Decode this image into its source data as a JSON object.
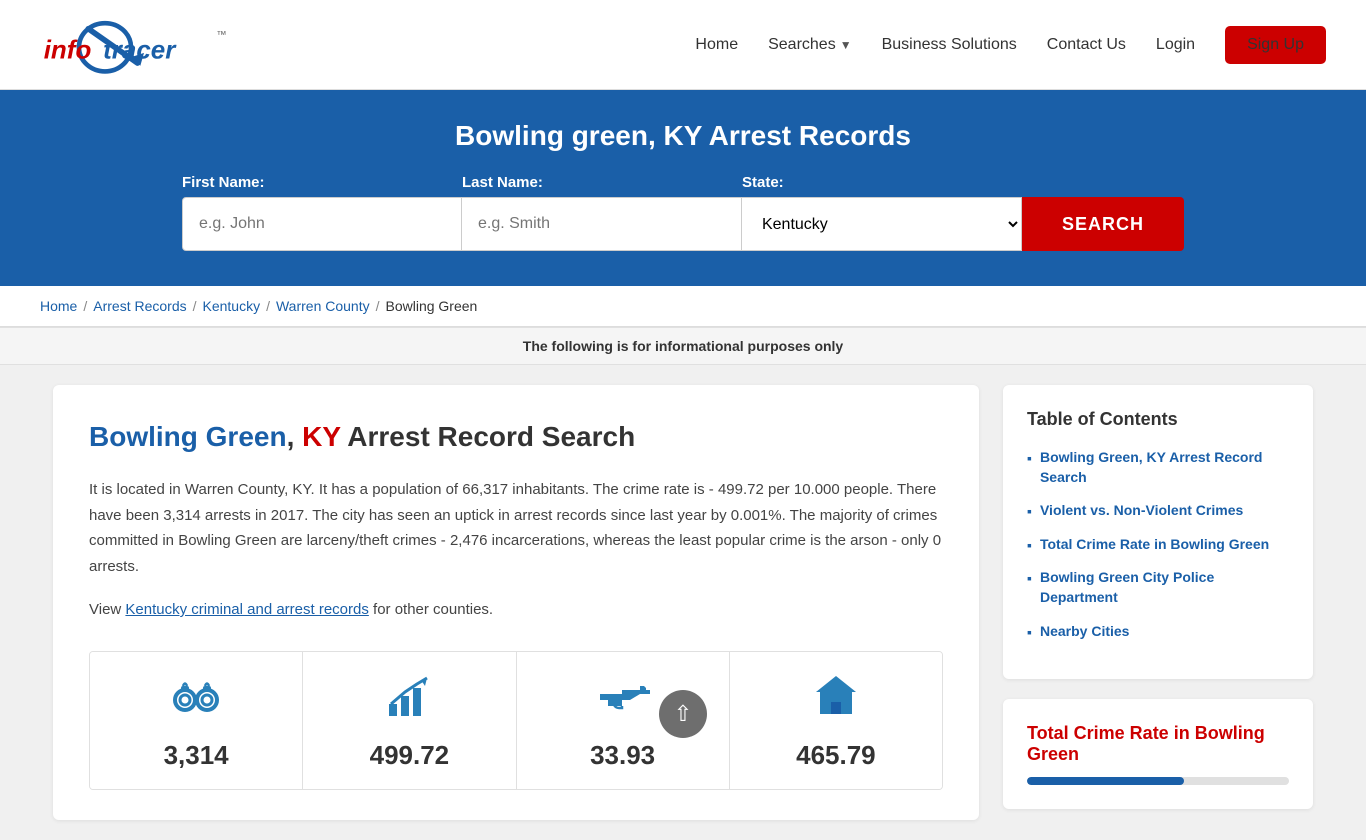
{
  "header": {
    "logo_alt": "InfoTracer",
    "nav": {
      "home": "Home",
      "searches": "Searches",
      "business_solutions": "Business Solutions",
      "contact_us": "Contact Us",
      "login": "Login",
      "signup": "Sign Up"
    }
  },
  "hero": {
    "title": "Bowling green, KY Arrest Records",
    "form": {
      "first_name_label": "First Name:",
      "first_name_placeholder": "e.g. John",
      "last_name_label": "Last Name:",
      "last_name_placeholder": "e.g. Smith",
      "state_label": "State:",
      "state_value": "Kentucky",
      "search_button": "SEARCH"
    }
  },
  "breadcrumb": {
    "home": "Home",
    "arrest_records": "Arrest Records",
    "kentucky": "Kentucky",
    "warren_county": "Warren County",
    "bowling_green": "Bowling Green"
  },
  "info_banner": "The following is for informational purposes only",
  "main": {
    "heading_city": "Bowling Green",
    "heading_state": "KY",
    "heading_rest": "Arrest Record Search",
    "description1": "It is located in Warren County, KY. It has a population of 66,317 inhabitants. The crime rate is - 499.72 per 10.000 people. There have been 3,314 arrests in 2017. The city has seen an uptick in arrest records since last year by 0.001%. The majority of crimes committed in Bowling Green are larceny/theft crimes - 2,476 incarcerations, whereas the least popular crime is the arson - only 0 arrests.",
    "description2_prefix": "View ",
    "description2_link": "Kentucky criminal and arrest records",
    "description2_suffix": " for other counties.",
    "stats": [
      {
        "value": "3,314",
        "icon": "handcuffs",
        "label": "Arrests"
      },
      {
        "value": "499.72",
        "icon": "chart",
        "label": "Crime Rate"
      },
      {
        "value": "33.93",
        "icon": "gun",
        "label": "Violent Crime"
      },
      {
        "value": "465.79",
        "icon": "house",
        "label": "Property Crime"
      }
    ]
  },
  "sidebar": {
    "toc_title": "Table of Contents",
    "toc_items": [
      {
        "text": "Bowling Green, KY Arrest Record Search",
        "href": "#"
      },
      {
        "text": "Violent vs. Non-Violent Crimes",
        "href": "#"
      },
      {
        "text": "Total Crime Rate in Bowling Green",
        "href": "#"
      },
      {
        "text": "Bowling Green City Police Department",
        "href": "#"
      },
      {
        "text": "Nearby Cities",
        "href": "#"
      }
    ],
    "crime_rate_title": "Total Crime Rate in Bowling Green"
  }
}
